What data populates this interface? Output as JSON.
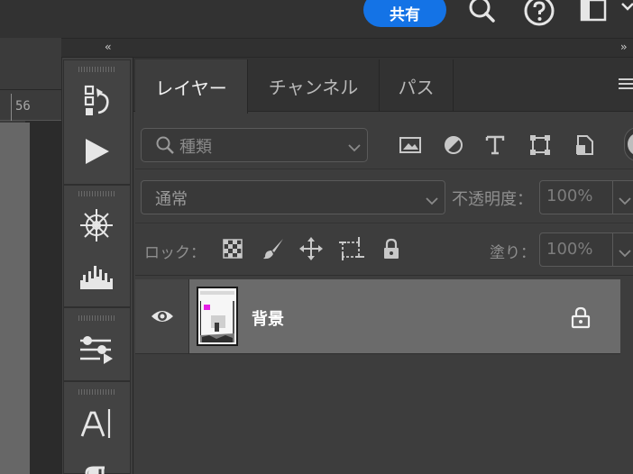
{
  "topbar": {
    "share_label": "共有",
    "icons": [
      "search-icon",
      "help-icon",
      "workspace-icon",
      "chevron-down-icon"
    ]
  },
  "canvas": {
    "ruler_label": "56"
  },
  "panel_strip": {
    "collapse_left": "‹‹",
    "collapse_right": "››",
    "icons": [
      "history-icon",
      "actions-play-icon",
      "brush-settings-icon",
      "histogram-icon",
      "adjustments-icon",
      "character-icon",
      "paragraph-icon"
    ]
  },
  "layers_panel": {
    "tabs": [
      {
        "label": "レイヤー",
        "active": true
      },
      {
        "label": "チャンネル",
        "active": false
      },
      {
        "label": "パス",
        "active": false
      }
    ],
    "filter": {
      "label": "種類",
      "icons": [
        "image-filter-icon",
        "adjustment-filter-icon",
        "type-filter-icon",
        "shape-filter-icon",
        "smart-object-filter-icon"
      ]
    },
    "blend": {
      "mode": "通常",
      "opacity_label": "不透明度：",
      "opacity_value": "100%"
    },
    "lock": {
      "label": "ロック：",
      "icons": [
        "lock-transparent-icon",
        "lock-pixels-icon",
        "lock-position-icon",
        "lock-artboard-icon",
        "lock-all-icon"
      ],
      "fill_label": "塗り：",
      "fill_value": "100%"
    },
    "layers": [
      {
        "name": "背景",
        "visible": true,
        "locked": true
      }
    ]
  },
  "colors": {
    "accent": "#1473e6",
    "panel_bg": "#3d3d3d",
    "selected_layer": "#6b6b6b"
  }
}
